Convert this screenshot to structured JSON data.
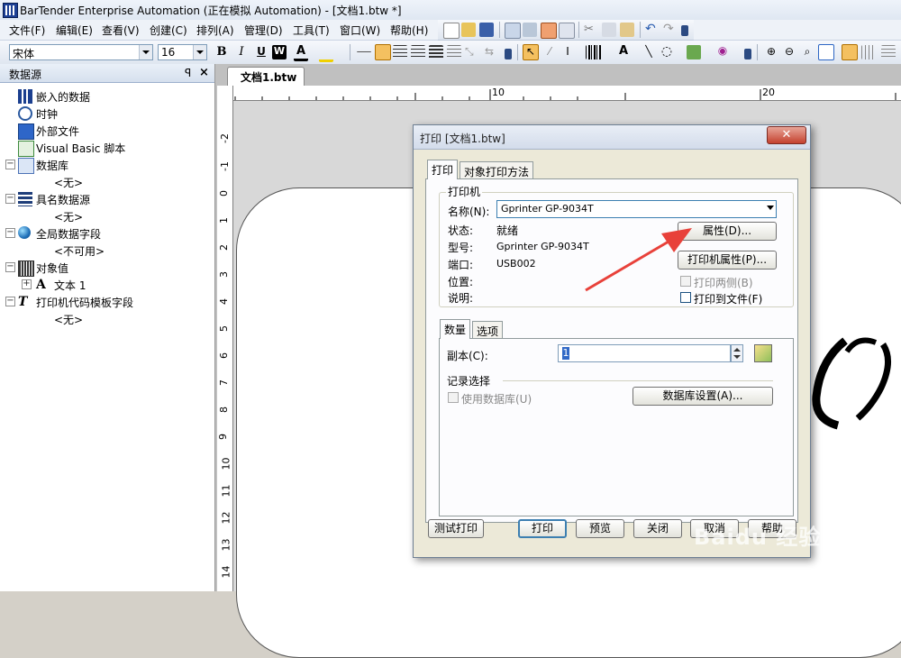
{
  "window": {
    "title": "BarTender Enterprise Automation (正在模拟 Automation) - [文档1.btw *]"
  },
  "menu": [
    "文件(F)",
    "编辑(E)",
    "查看(V)",
    "创建(C)",
    "排列(A)",
    "管理(D)",
    "工具(T)",
    "窗口(W)",
    "帮助(H)"
  ],
  "format_toolbar": {
    "font": "宋体",
    "size": "16",
    "bold": "B",
    "italic": "I",
    "underline": "U",
    "wordart": "W",
    "font_color": "A"
  },
  "datasource_pane": {
    "title": "数据源",
    "items": [
      {
        "label": "嵌入的数据",
        "icon": "embedded-data-icon"
      },
      {
        "label": "时钟",
        "icon": "clock-icon"
      },
      {
        "label": "外部文件",
        "icon": "external-file-icon"
      },
      {
        "label": "Visual Basic 脚本",
        "icon": "vbscript-icon"
      },
      {
        "label": "数据库",
        "icon": "database-icon",
        "child": "<无>"
      },
      {
        "label": "具名数据源",
        "icon": "named-datasource-icon",
        "child": "<无>"
      },
      {
        "label": "全局数据字段",
        "icon": "globe-icon",
        "child": "<不可用>"
      },
      {
        "label": "对象值",
        "icon": "object-value-icon"
      },
      {
        "label": "文本 1",
        "icon": "text-a-icon"
      },
      {
        "label": "打印机代码模板字段",
        "icon": "printer-code-icon",
        "child": "<无>"
      }
    ]
  },
  "document": {
    "tab": "文档1.btw *",
    "hruler": [
      "10",
      "20"
    ],
    "vruler": [
      "-2",
      "-1",
      "0",
      "1",
      "2",
      "3",
      "4",
      "5",
      "6",
      "7",
      "8",
      "9",
      "10",
      "11",
      "12",
      "13",
      "14"
    ],
    "watermark": "Baidu 经验"
  },
  "print_dialog": {
    "title": "打印 [文档1.btw]",
    "tabs": [
      "打印",
      "对象打印方法"
    ],
    "printer_group": "打印机",
    "name_label": "名称(N):",
    "printer_name": "Gprinter  GP-9034T",
    "status_label": "状态:",
    "status_value": "就绪",
    "model_label": "型号:",
    "model_value": "Gprinter  GP-9034T",
    "port_label": "端口:",
    "port_value": "USB002",
    "location_label": "位置:",
    "comment_label": "说明:",
    "properties_button": "属性(D)...",
    "printer_props_button": "打印机属性(P)...",
    "duplex_label": "打印两侧(B)",
    "print_to_file_label": "打印到文件(F)",
    "sub_tabs": [
      "数量",
      "选项"
    ],
    "copies_label": "副本(C):",
    "copies_value": "1",
    "record_select": "记录选择",
    "use_db_label": "使用数据库(U)",
    "db_settings_button": "数据库设置(A)...",
    "test_print_button": "测试打印",
    "print_button": "打印",
    "preview_button": "预览",
    "close_button": "关闭",
    "cancel_button": "取消",
    "help_button": "帮助"
  },
  "colors": {
    "accent": "#3c7fb1",
    "arrow": "#e8413a",
    "close": "#c4412e"
  }
}
